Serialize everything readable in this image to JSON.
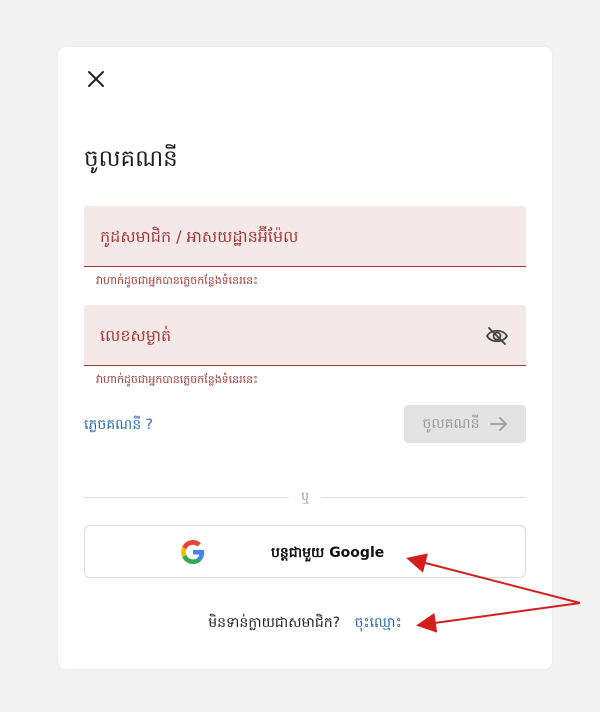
{
  "login": {
    "title": "ចូលគណនី",
    "member_field": {
      "placeholder": "កូដសមាជិក / អាសយដ្ឋានអ៊ីម៉ែល",
      "error": "វាហាក់ដូចជាអ្នកបានភ្លេចកន្លែងទំនេរនេះ"
    },
    "password_field": {
      "placeholder": "លេខសម្ងាត់",
      "error": "វាហាក់ដូចជាអ្នកបានភ្លេចកន្លែងទំនេរនេះ"
    },
    "forgot_link": "ភ្លេចគណនី ?",
    "login_button": "ចូលគណនី",
    "divider_text": "ឬ",
    "google_button": "បន្តជាមួយ Google",
    "signup_question": "មិនទាន់ក្លាយជាសមាជិក?",
    "signup_link": "ចុះឈ្មោះ"
  },
  "colors": {
    "accent_error": "#a33a3a",
    "field_bg": "#f5e8e8",
    "link": "#2b6cb0",
    "annotation_arrow": "#d41f1f"
  },
  "icons": {
    "close": "close-icon",
    "password_toggle": "eye-off-icon",
    "login_arrow": "arrow-right-icon",
    "google": "google-logo-icon"
  }
}
